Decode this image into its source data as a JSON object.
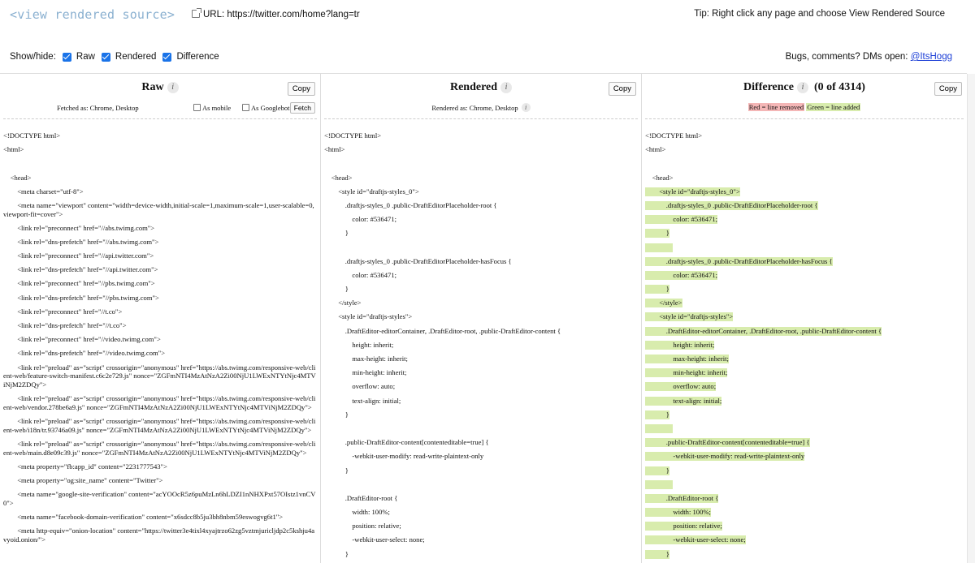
{
  "header": {
    "logo": "<view rendered source>",
    "url_label": "URL: https://twitter.com/home?lang=tr",
    "tip": "Tip: Right click any page and choose View Rendered Source",
    "showhide_label": "Show/hide:",
    "toggle_raw": "Raw",
    "toggle_rendered": "Rendered",
    "toggle_difference": "Difference",
    "bugs_text": "Bugs, comments? DMs open: ",
    "bugs_link": "@ItsHogg"
  },
  "raw": {
    "title": "Raw",
    "copy": "Copy",
    "fetched_as": "Fetched as: Chrome, Desktop",
    "as_mobile": "As mobile",
    "as_googlebot": "As Googlebot",
    "fetch": "Fetch",
    "lines": [
      "<!DOCTYPE html>",
      "<html>",
      "",
      "    <head>",
      "        <meta charset=\"utf-8\">",
      "        <meta name=\"viewport\" content=\"width=device-width,initial-scale=1,maximum-scale=1,user-scalable=0,viewport-fit=cover\">",
      "        <link rel=\"preconnect\" href=\"//abs.twimg.com\">",
      "        <link rel=\"dns-prefetch\" href=\"//abs.twimg.com\">",
      "        <link rel=\"preconnect\" href=\"//api.twitter.com\">",
      "        <link rel=\"dns-prefetch\" href=\"//api.twitter.com\">",
      "        <link rel=\"preconnect\" href=\"//pbs.twimg.com\">",
      "        <link rel=\"dns-prefetch\" href=\"//pbs.twimg.com\">",
      "        <link rel=\"preconnect\" href=\"//t.co\">",
      "        <link rel=\"dns-prefetch\" href=\"//t.co\">",
      "        <link rel=\"preconnect\" href=\"//video.twimg.com\">",
      "        <link rel=\"dns-prefetch\" href=\"//video.twimg.com\">",
      "        <link rel=\"preload\" as=\"script\" crossorigin=\"anonymous\" href=\"https://abs.twimg.com/responsive-web/client-web/feature-switch-manifest.c6c2e729.js\" nonce=\"ZGFmNTI4MzAtNzA2Zi00NjU1LWExNTYtNjc4MTViNjM2ZDQy\">",
      "        <link rel=\"preload\" as=\"script\" crossorigin=\"anonymous\" href=\"https://abs.twimg.com/responsive-web/client-web/vendor.278be6a9.js\" nonce=\"ZGFmNTI4MzAtNzA2Zi00NjU1LWExNTYtNjc4MTViNjM2ZDQy\">",
      "        <link rel=\"preload\" as=\"script\" crossorigin=\"anonymous\" href=\"https://abs.twimg.com/responsive-web/client-web/i18n/tr.93746a09.js\" nonce=\"ZGFmNTI4MzAtNzA2Zi00NjU1LWExNTYtNjc4MTViNjM2ZDQy\">",
      "        <link rel=\"preload\" as=\"script\" crossorigin=\"anonymous\" href=\"https://abs.twimg.com/responsive-web/client-web/main.d8e09c39.js\" nonce=\"ZGFmNTI4MzAtNzA2Zi00NjU1LWExNTYtNjc4MTViNjM2ZDQy\">",
      "        <meta property=\"fb:app_id\" content=\"2231777543\">",
      "        <meta property=\"og:site_name\" content=\"Twitter\">",
      "        <meta name=\"google-site-verification\" content=\"acYOOcR5z6puMzLn6hLDZI1nNHXPxt57OIstz1vnCV0\">",
      "        <meta name=\"facebook-domain-verification\" content=\"x6sdcc8b5ju3bh8nbm59eswogvg6t1\">",
      "        <meta http-equiv=\"onion-location\" content=\"https://twitter3e4tixl4xyajtrzo62zg5vztmjuricljdp2c5kshju4avyoid.onion/\">"
    ]
  },
  "rendered": {
    "title": "Rendered",
    "copy": "Copy",
    "rendered_as": "Rendered as: Chrome, Desktop",
    "lines": [
      "<!DOCTYPE html>",
      "<html>",
      "",
      "    <head>",
      "        <style id=\"draftjs-styles_0\">",
      "            .draftjs-styles_0 .public-DraftEditorPlaceholder-root {",
      "                color: #536471;",
      "            }",
      "",
      "            .draftjs-styles_0 .public-DraftEditorPlaceholder-hasFocus {",
      "                color: #536471;",
      "            }",
      "        </style>",
      "        <style id=\"draftjs-styles\">",
      "            .DraftEditor-editorContainer, .DraftEditor-root, .public-DraftEditor-content {",
      "                height: inherit;",
      "                max-height: inherit;",
      "                min-height: inherit;",
      "                overflow: auto;",
      "                text-align: initial;",
      "            }",
      "",
      "            .public-DraftEditor-content[contenteditable=true] {",
      "                -webkit-user-modify: read-write-plaintext-only",
      "            }",
      "",
      "            .DraftEditor-root {",
      "                width: 100%;",
      "                position: relative;",
      "                -webkit-user-select: none;",
      "            }"
    ]
  },
  "difference": {
    "title": "Difference",
    "count": "(0 of 4314)",
    "copy": "Copy",
    "legend_removed": "Red = line removed",
    "legend_added": "Green = line added",
    "lines": [
      {
        "text": "<!DOCTYPE html>",
        "added": false
      },
      {
        "text": "<html>",
        "added": false
      },
      {
        "text": "",
        "added": false
      },
      {
        "text": "    <head>",
        "added": false
      },
      {
        "text": "        <style id=\"draftjs-styles_0\">",
        "added": true
      },
      {
        "text": "            .draftjs-styles_0 .public-DraftEditorPlaceholder-root {",
        "added": true
      },
      {
        "text": "                color: #536471;",
        "added": true
      },
      {
        "text": "            }",
        "added": true
      },
      {
        "text": "",
        "added": true
      },
      {
        "text": "            .draftjs-styles_0 .public-DraftEditorPlaceholder-hasFocus {",
        "added": true
      },
      {
        "text": "                color: #536471;",
        "added": true
      },
      {
        "text": "            }",
        "added": true
      },
      {
        "text": "        </style>",
        "added": true
      },
      {
        "text": "        <style id=\"draftjs-styles\">",
        "added": true
      },
      {
        "text": "            .DraftEditor-editorContainer, .DraftEditor-root, .public-DraftEditor-content {",
        "added": true
      },
      {
        "text": "                height: inherit;",
        "added": true
      },
      {
        "text": "                max-height: inherit;",
        "added": true
      },
      {
        "text": "                min-height: inherit;",
        "added": true
      },
      {
        "text": "                overflow: auto;",
        "added": true
      },
      {
        "text": "                text-align: initial;",
        "added": true
      },
      {
        "text": "            }",
        "added": true
      },
      {
        "text": "",
        "added": true
      },
      {
        "text": "            .public-DraftEditor-content[contenteditable=true] {",
        "added": true
      },
      {
        "text": "                -webkit-user-modify: read-write-plaintext-only",
        "added": true
      },
      {
        "text": "            }",
        "added": true
      },
      {
        "text": "",
        "added": true
      },
      {
        "text": "            .DraftEditor-root {",
        "added": true
      },
      {
        "text": "                width: 100%;",
        "added": true
      },
      {
        "text": "                position: relative;",
        "added": true
      },
      {
        "text": "                -webkit-user-select: none;",
        "added": true
      },
      {
        "text": "            }",
        "added": true
      }
    ]
  }
}
